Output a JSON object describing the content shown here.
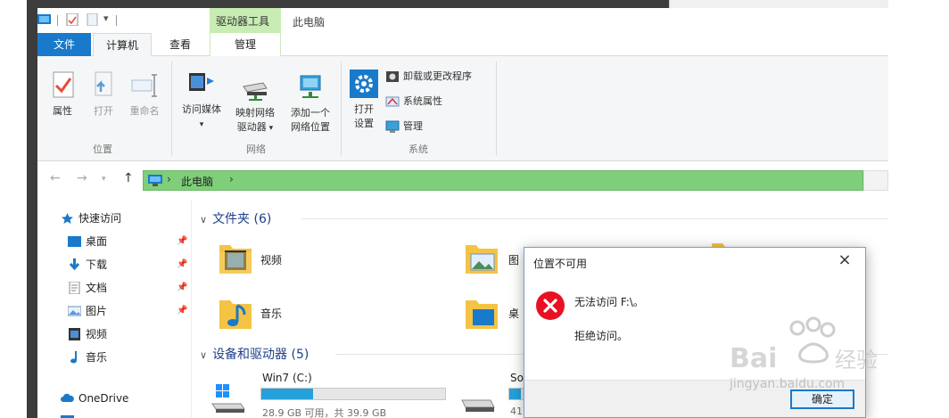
{
  "window": {
    "title": "此电脑"
  },
  "ribbon_context": {
    "label": "驱动器工具"
  },
  "tabs": [
    {
      "label": "文件"
    },
    {
      "label": "计算机"
    },
    {
      "label": "查看"
    },
    {
      "label": "管理"
    }
  ],
  "ribbon": {
    "location": {
      "label": "位置",
      "properties": "属性",
      "open": "打开",
      "rename": "重命名"
    },
    "network": {
      "label": "网络",
      "media": "访问媒体",
      "map_drive_line1": "映射网络",
      "map_drive_line2": "驱动器",
      "add_location_line1": "添加一个",
      "add_location_line2": "网络位置"
    },
    "system": {
      "label": "系统",
      "open_settings_line1": "打开",
      "open_settings_line2": "设置",
      "uninstall": "卸载或更改程序",
      "sys_props": "系统属性",
      "manage": "管理"
    }
  },
  "address": {
    "path": "此电脑"
  },
  "nav": {
    "quick_access": "快速访问",
    "items": [
      {
        "label": "桌面"
      },
      {
        "label": "下载"
      },
      {
        "label": "文档"
      },
      {
        "label": "图片"
      },
      {
        "label": "视频"
      },
      {
        "label": "音乐"
      }
    ],
    "onedrive": "OneDrive"
  },
  "content": {
    "folders_header": "文件夹 (6)",
    "folders": [
      {
        "label": "视频"
      },
      {
        "label": "音乐"
      },
      {
        "label": "图"
      },
      {
        "label": "桌"
      }
    ],
    "drives_header": "设备和驱动器 (5)",
    "drives": [
      {
        "label": "Win7 (C:)",
        "sub": "28.9 GB 可用，共 39.9 GB",
        "used_fraction": 0.28
      },
      {
        "label": "So",
        "sub": "41",
        "used_fraction": 0.35
      }
    ]
  },
  "dialog": {
    "title": "位置不可用",
    "message": "无法访问 F:\\。",
    "detail": "拒绝访问。",
    "ok": "确定",
    "close": "×"
  },
  "watermark": {
    "text": "jingyan.baidu.com"
  },
  "colors": {
    "accent": "#1979ca",
    "address_bar": "#7fce7a",
    "drive_tools": "#c8ecb4",
    "error": "#e81123"
  }
}
